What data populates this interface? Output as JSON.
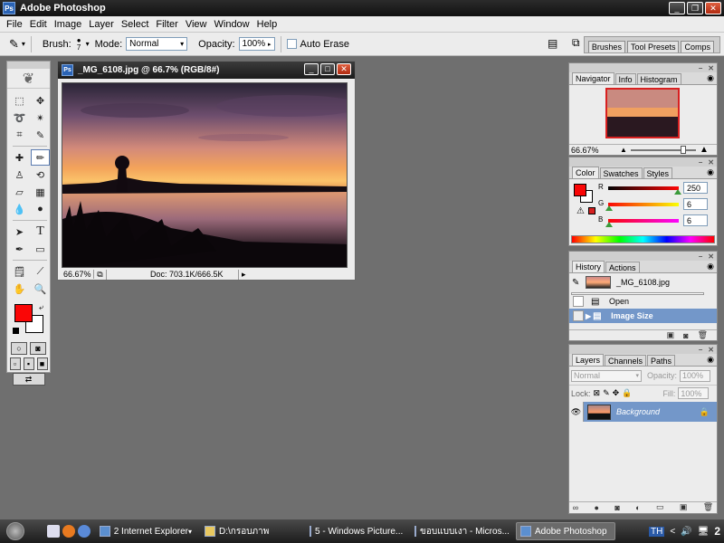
{
  "window": {
    "title": "Adobe Photoshop"
  },
  "menu": [
    "File",
    "Edit",
    "Image",
    "Layer",
    "Select",
    "Filter",
    "View",
    "Window",
    "Help"
  ],
  "options": {
    "brush_label": "Brush:",
    "brush_size": "7",
    "mode_label": "Mode:",
    "mode_value": "Normal",
    "opacity_label": "Opacity:",
    "opacity_value": "100%",
    "auto_erase_label": "Auto Erase"
  },
  "palette_well": [
    "Brushes",
    "Tool Presets",
    "Comps"
  ],
  "document": {
    "title": "_MG_6108.jpg @ 66.7% (RGB/8#)",
    "zoom": "66.67%",
    "doc_size": "Doc: 703.1K/666.5K"
  },
  "navigator": {
    "tabs": [
      "Navigator",
      "Info",
      "Histogram"
    ],
    "zoom": "66.67%"
  },
  "color": {
    "tabs": [
      "Color",
      "Swatches",
      "Styles"
    ],
    "r_label": "R",
    "g_label": "G",
    "b_label": "B",
    "r": "250",
    "g": "6",
    "b": "6",
    "foreground": "#fa0606"
  },
  "history": {
    "tabs": [
      "History",
      "Actions"
    ],
    "snapshot": "_MG_6108.jpg",
    "items": [
      "Open",
      "Image Size"
    ]
  },
  "layers": {
    "tabs": [
      "Layers",
      "Channels",
      "Paths"
    ],
    "blend": "Normal",
    "opacity_label": "Opacity:",
    "opacity": "100%",
    "lock_label": "Lock:",
    "fill_label": "Fill:",
    "fill": "100%",
    "layer_name": "Background"
  },
  "taskbar": {
    "buttons": [
      "2 Internet Explorer",
      "D:\\กรอบภาพ",
      "5 - Windows Picture...",
      "ขอบแบบเงา - Micros...",
      "Adobe Photoshop"
    ],
    "clock": "2"
  }
}
